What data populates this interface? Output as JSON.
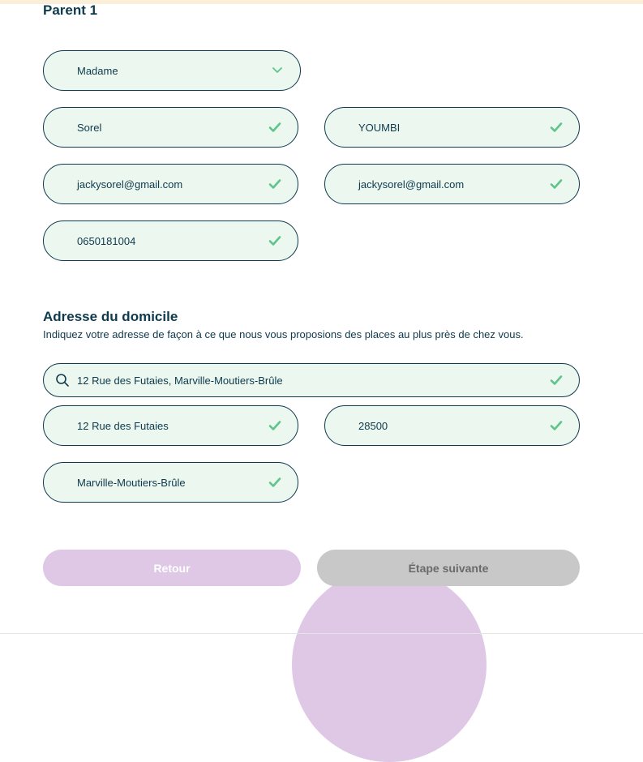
{
  "parent_section": {
    "title": "Parent 1",
    "civility": {
      "value": "Madame"
    },
    "first_name": {
      "value": "Sorel"
    },
    "last_name": {
      "value": "YOUMBI"
    },
    "email": {
      "value": "jackysorel@gmail.com"
    },
    "email_confirm": {
      "value": "jackysorel@gmail.com"
    },
    "phone": {
      "value": "0650181004"
    }
  },
  "address_section": {
    "title": "Adresse du domicile",
    "subtitle": "Indiquez votre adresse de façon à ce que nous vous proposions des places au plus près de chez vous.",
    "search": {
      "value": "12 Rue des Futaies, Marville-Moutiers-Brûle"
    },
    "street": {
      "value": "12 Rue des Futaies"
    },
    "postal_code": {
      "value": "28500"
    },
    "city": {
      "value": "Marville-Moutiers-Brûle"
    }
  },
  "actions": {
    "back_label": "Retour",
    "next_label": "Étape suivante"
  },
  "colors": {
    "field_bg": "#ebf7ef",
    "border": "#0e3a4d",
    "check": "#5ec48a",
    "back_button": "#dec8e6",
    "next_button": "#c8c8c8",
    "top_strip": "#fbefd9"
  },
  "icons": {
    "valid": "check-icon",
    "dropdown": "chevron-down-icon",
    "search": "search-icon"
  }
}
